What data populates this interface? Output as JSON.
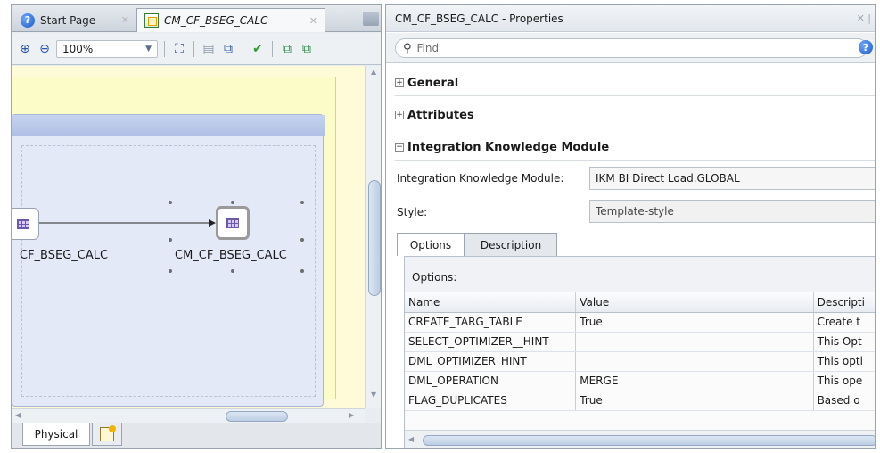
{
  "left_pane": {
    "tabs": [
      {
        "label": "Start Page",
        "icon": "help-icon"
      },
      {
        "label": "CM_CF_BSEG_CALC",
        "icon": "diagram-icon"
      }
    ],
    "toolbar": {
      "zoom": "100%"
    },
    "diagram": {
      "nodes": [
        {
          "label": "CF_BSEG_CALC",
          "icon": "datastore-icon"
        },
        {
          "label": "CM_CF_BSEG_CALC",
          "icon": "datastore-icon"
        }
      ]
    },
    "bottom_tabs": [
      {
        "label": "Physical"
      }
    ]
  },
  "properties": {
    "title": "CM_CF_BSEG_CALC - Properties",
    "find_placeholder": "Find",
    "sections": {
      "general": "General",
      "attributes": "Attributes",
      "ikm": "Integration Knowledge Module"
    },
    "ikm_label": "Integration Knowledge Module:",
    "ikm_value": "IKM BI Direct Load.GLOBAL",
    "style_label": "Style:",
    "style_value": "Template-style",
    "tabs": [
      "Options",
      "Description"
    ],
    "options_header": "Options:",
    "columns": [
      "Name",
      "Value",
      "Descripti"
    ],
    "rows": [
      {
        "name": "CREATE_TARG_TABLE",
        "value": "True",
        "desc": "Create t"
      },
      {
        "name": "SELECT_OPTIMIZER__HINT",
        "value": "",
        "desc": "This Opt"
      },
      {
        "name": "DML_OPTIMIZER_HINT",
        "value": "",
        "desc": "This opti"
      },
      {
        "name": "DML_OPERATION",
        "value": "MERGE",
        "desc": "This ope"
      },
      {
        "name": "FLAG_DUPLICATES",
        "value": "True",
        "desc": "Based o"
      }
    ]
  }
}
